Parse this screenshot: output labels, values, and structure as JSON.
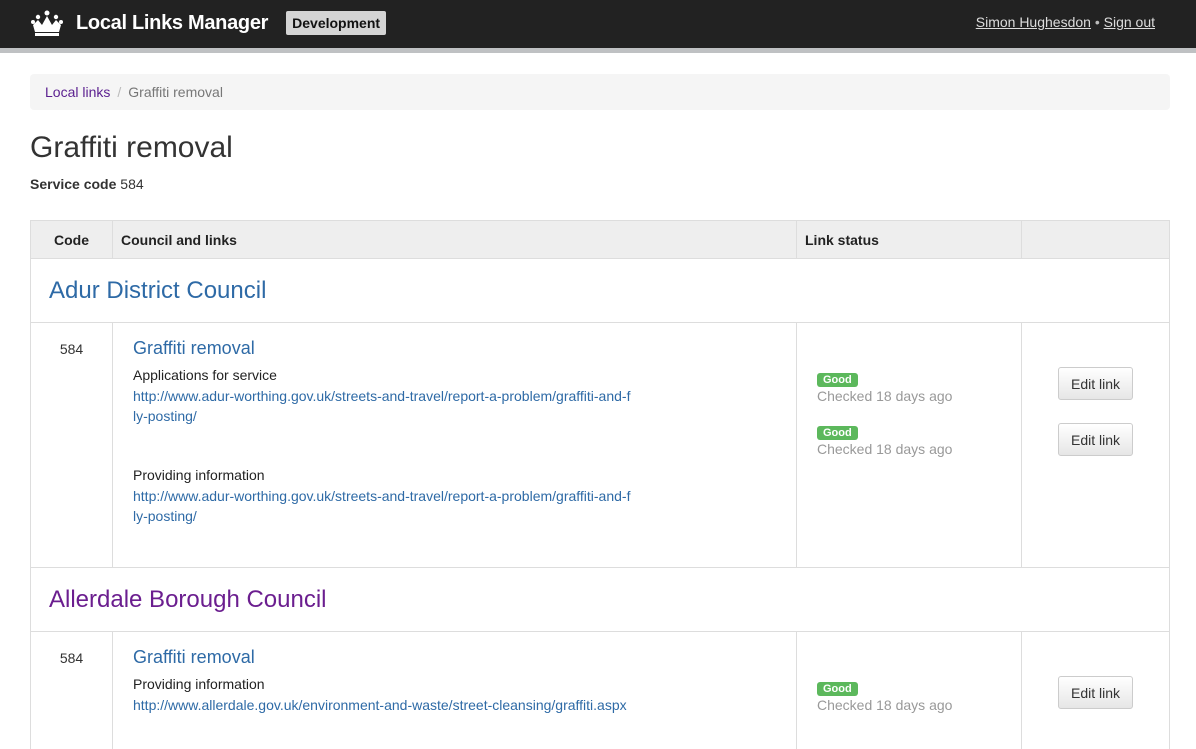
{
  "header": {
    "app_title": "Local Links Manager",
    "env_badge": "Development",
    "user_name": "Simon Hughesdon",
    "separator": "•",
    "sign_out": "Sign out"
  },
  "breadcrumb": {
    "root": "Local links",
    "separator": "/",
    "current": "Graffiti removal"
  },
  "page": {
    "title": "Graffiti removal",
    "service_code_label": "Service code",
    "service_code_value": "584"
  },
  "table": {
    "headers": [
      "Code",
      "Council and links",
      "Link status",
      ""
    ],
    "councils": [
      {
        "name": "Adur District Council",
        "code": "584",
        "service": "Graffiti removal",
        "links": [
          {
            "label": "Applications for service",
            "url": "http://www.adur-worthing.gov.uk/streets-and-travel/report-a-problem/graffiti-and-fly-posting/",
            "status": "Good",
            "checked": "Checked 18 days ago",
            "action": "Edit link"
          },
          {
            "label": "Providing information",
            "url": "http://www.adur-worthing.gov.uk/streets-and-travel/report-a-problem/graffiti-and-fly-posting/",
            "status": "Good",
            "checked": "Checked 18 days ago",
            "action": "Edit link"
          }
        ]
      },
      {
        "name": "Allerdale Borough Council",
        "code": "584",
        "service": "Graffiti removal",
        "links": [
          {
            "label": "Providing information",
            "url": "http://www.allerdale.gov.uk/environment-and-waste/street-cleansing/graffiti.aspx",
            "status": "Good",
            "checked": "Checked 18 days ago",
            "action": "Edit link"
          }
        ]
      }
    ]
  },
  "colors": {
    "topbar": "#222222",
    "link_blue": "#2e6aa6",
    "visited_purple": "#6b1e8f",
    "good_green": "#5cb85c"
  },
  "icons": {
    "logo": "crown-icon"
  }
}
